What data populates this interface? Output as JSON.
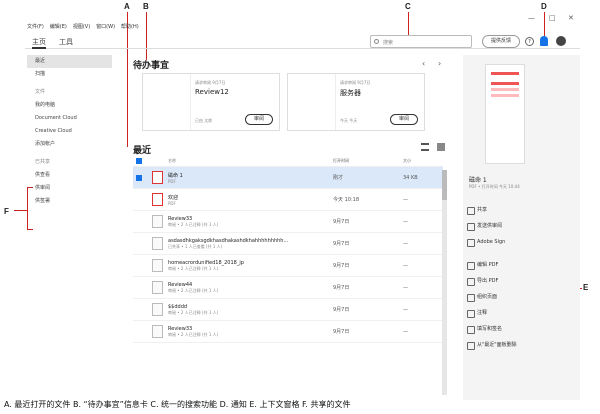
{
  "callouts": {
    "a": "A",
    "b": "B",
    "c": "C",
    "d": "D",
    "e": "E",
    "f": "F"
  },
  "menu": [
    "文件(F)",
    "编辑(E)",
    "视图(V)",
    "窗口(W)",
    "帮助(H)"
  ],
  "window": {
    "min": "—",
    "max": "□",
    "close": "✕"
  },
  "tabs": {
    "home": "主页",
    "tools": "工具"
  },
  "search": {
    "placeholder": "搜索"
  },
  "top": {
    "try": "提供反馈",
    "help": "?"
  },
  "sidebar": {
    "recent": "最近",
    "scan": "扫描",
    "file_hdr": "文件",
    "my_pc": "我的电脑",
    "doc_cloud": "Document Cloud",
    "creative_cloud": "Creative Cloud",
    "add_account": "添加帐户",
    "shared_hdr": "已共享",
    "view": "供查看",
    "review": "供审阅",
    "sign": "供签署"
  },
  "todo": {
    "title": "待办事宜",
    "cards": [
      {
        "meta": "请求审阅 9月7日",
        "title": "Review12",
        "foot": "已由 太郎",
        "btn": "审阅"
      },
      {
        "meta": "请求审阅 9月7日",
        "title": "服务器",
        "foot": "今天 今天",
        "btn": "审阅"
      }
    ]
  },
  "recent": {
    "title": "最近"
  },
  "table": {
    "headers": {
      "name": "名称",
      "time": "打开时间",
      "size": "大小"
    },
    "rows": [
      {
        "name": "磁命 1",
        "sub": "PDF",
        "time": "刚才",
        "size": "34 KB"
      },
      {
        "name": "欢迎",
        "sub": "PDF",
        "time": "今天 10:18",
        "size": "—"
      },
      {
        "name": "Review33",
        "sub": "审阅 • 2 人已注释 (共 1 人)",
        "time": "9月7日",
        "size": "—"
      },
      {
        "name": "asdasdhkgaksgdkhasdhakashdkhahhhhhhhhh...",
        "sub": "已共享 • 1 人已查看 (共 1 人)",
        "time": "9月7日",
        "size": "—"
      },
      {
        "name": "homeacrordunified18_2018_jp",
        "sub": "审阅 • 2 人已注释 (共 1 人)",
        "time": "9月7日",
        "size": "—"
      },
      {
        "name": "Review44",
        "sub": "审阅 • 2 人已注释 (共 1 人)",
        "time": "9月7日",
        "size": "—"
      },
      {
        "name": "$$dddd",
        "sub": "审阅 • 2 人已注释 (共 1 人)",
        "time": "9月7日",
        "size": "—"
      },
      {
        "name": "Review33",
        "sub": "审阅 • 2 人已注释 (共 1 人)",
        "time": "9月7日",
        "size": "—"
      }
    ]
  },
  "right": {
    "doc_title": "磁命 1",
    "doc_meta": "PDF • 打开时间 今天 10:44",
    "tools": [
      "共享",
      "发送供审阅",
      "Adobe Sign",
      "编辑 PDF",
      "导出 PDF",
      "组织页面",
      "注释",
      "填写和签名",
      "从\"最近\"面板删除"
    ]
  },
  "caption": "A. 最近打开的文件 B. “待办事宜”信息卡 C. 统一的搜索功能 D. 通知 E. 上下文窗格 F. 共享的文件"
}
